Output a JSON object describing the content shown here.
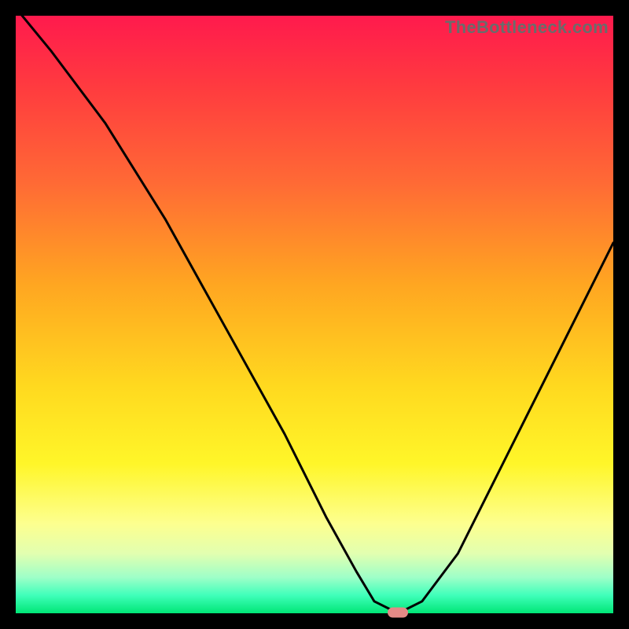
{
  "watermark": "TheBottleneck.com",
  "chart_data": {
    "type": "line",
    "title": "",
    "xlabel": "",
    "ylabel": "",
    "xlim": [
      0,
      100
    ],
    "ylim": [
      0,
      100
    ],
    "x": [
      0,
      6,
      15,
      25,
      35,
      45,
      52,
      57,
      60,
      64,
      68,
      74,
      80,
      86,
      92,
      100
    ],
    "values": [
      102,
      94,
      82,
      66,
      48,
      30,
      16,
      7,
      2,
      0,
      2,
      10,
      22,
      34,
      46,
      62
    ],
    "marker": {
      "x": 64,
      "y": 0
    },
    "note": "x is horizontal position (%), values is height (%) with 0 at bottom; curve is a V-shaped bottleneck profile"
  }
}
